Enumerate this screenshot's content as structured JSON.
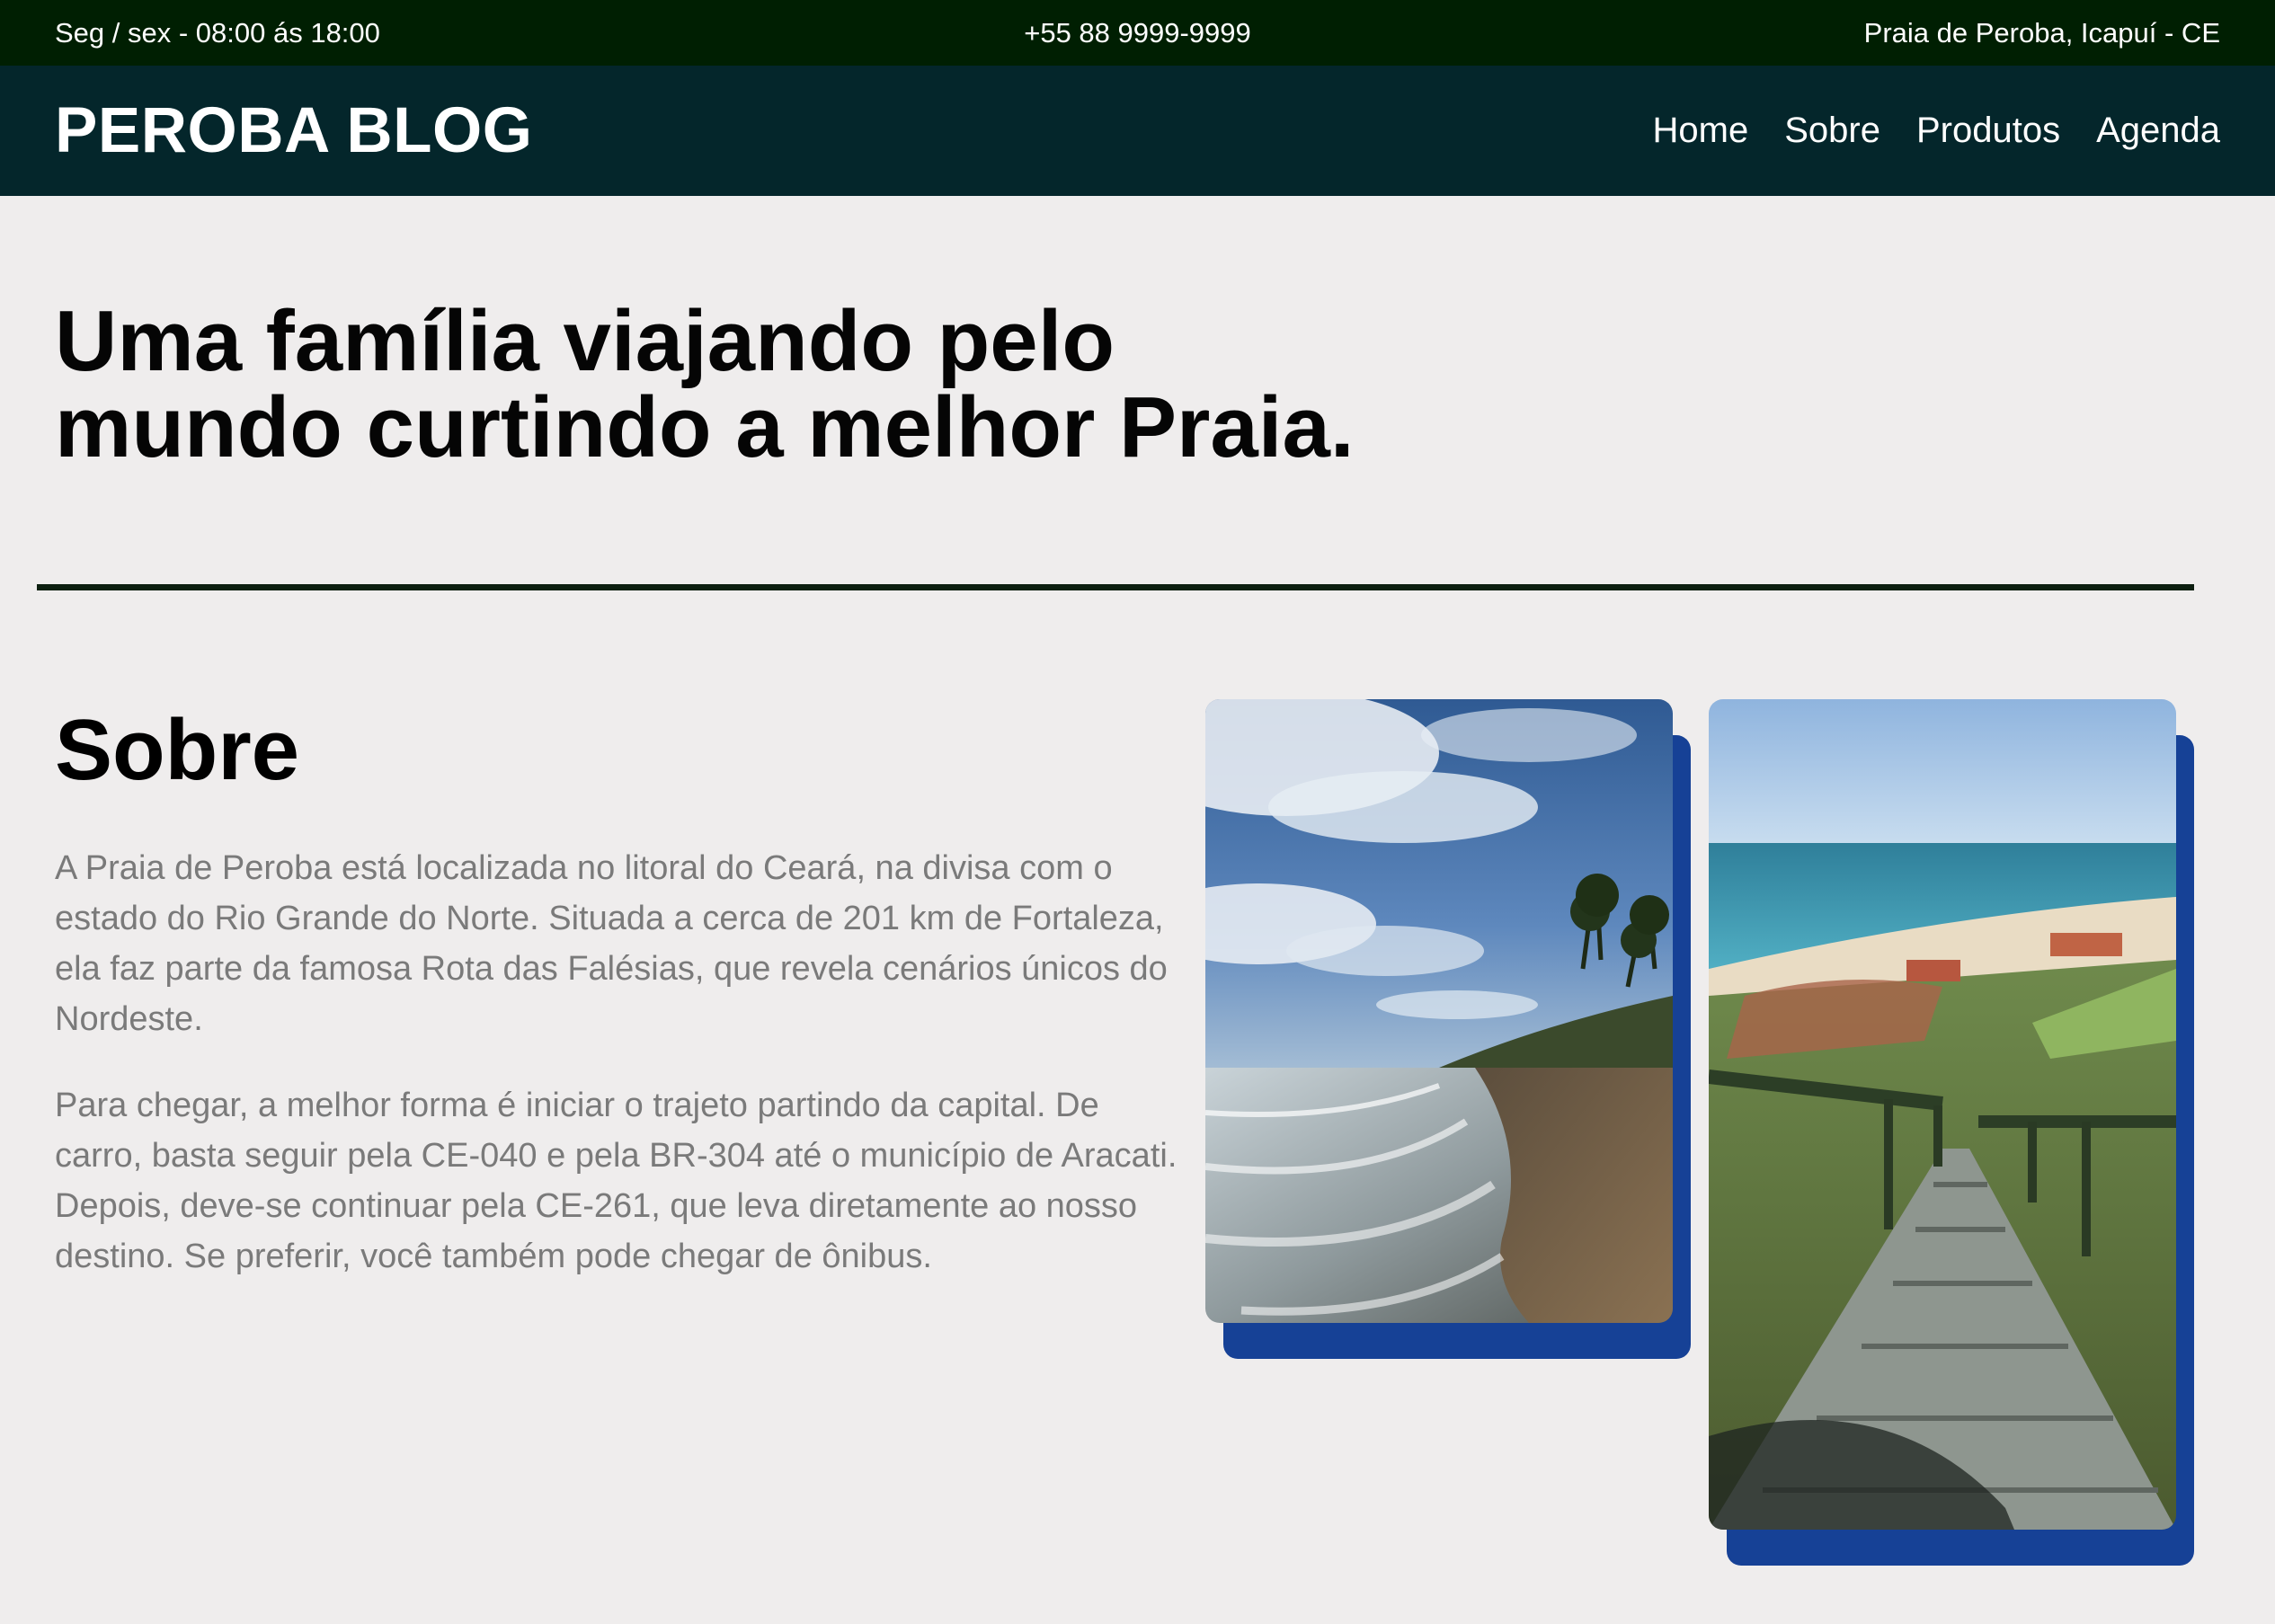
{
  "topbar": {
    "hours": "Seg / sex - 08:00 ás 18:00",
    "phone": "+55 88 9999-9999",
    "location": "Praia de Peroba, Icapuí - CE"
  },
  "header": {
    "brand": "PEROBA BLOG",
    "nav": [
      "Home",
      "Sobre",
      "Produtos",
      "Agenda"
    ]
  },
  "hero": {
    "title_line1": "Uma família viajando pelo",
    "title_line2": "mundo curtindo a melhor Praia."
  },
  "about": {
    "title": "Sobre",
    "paragraph1": "A Praia de Peroba está localizada no litoral do Ceará, na divisa com o estado do Rio Grande do Norte. Situada a cerca de 201 km de Fortaleza, ela faz parte da famosa Rota das Falésias, que revela cenários únicos do Nordeste.",
    "paragraph2": "Para chegar, a melhor forma é iniciar o trajeto partindo da capital. De carro, basta seguir pela CE-040 e pela BR-304 até o município de Aracati. Depois, deve-se continuar pela CE-261, que leva diretamente ao nosso destino. Se preferir, você também pode chegar de ônibus."
  },
  "colors": {
    "topbar_bg": "#001f02",
    "navbar_bg": "#04262b",
    "page_bg": "#efeded",
    "photo_shadow": "#164196",
    "body_text": "#7a7a7a"
  }
}
